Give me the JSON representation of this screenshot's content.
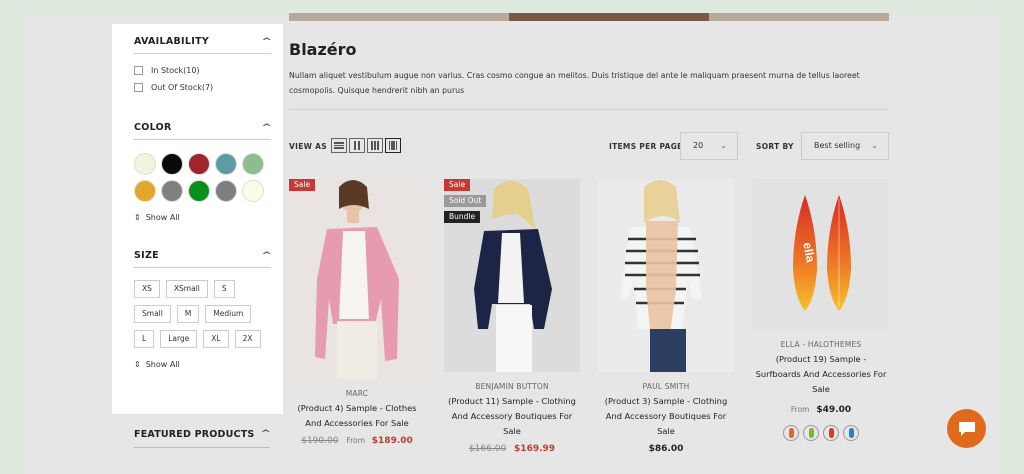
{
  "sidebar": {
    "availability": {
      "title": "AVAILABILITY",
      "options": [
        {
          "label": "In Stock(10)"
        },
        {
          "label": "Out Of Stock(7)"
        }
      ]
    },
    "color": {
      "title": "COLOR",
      "swatches": [
        "#f3f3dd",
        "#0a0a0a",
        "#a0242a",
        "#5d9ca5",
        "#8cbd8c",
        "#e1a82b",
        "#808080",
        "#0a8f1a",
        "#7e7e7e",
        "#fbfbe8"
      ],
      "show_all": "Show All"
    },
    "size": {
      "title": "SIZE",
      "options": [
        "XS",
        "XSmall",
        "S",
        "Small",
        "M",
        "Medium",
        "L",
        "Large",
        "XL",
        "2X"
      ],
      "show_all": "Show All"
    },
    "featured_title": "FEATURED PRODUCTS"
  },
  "main": {
    "title": "Blazéro",
    "description": "Nullam aliquet vestibulum augue non varius. Cras cosmo congue an melitos. Duis tristique del ante le maliquam praesent murna de tellus laoreet cosmopolis. Quisque hendrerit nibh an purus",
    "view_as_label": "VIEW AS",
    "items_per_page_label": "ITEMS PER PAGE",
    "items_per_page_value": "20",
    "sort_by_label": "SORT BY",
    "sort_by_value": "Best selling"
  },
  "products": [
    {
      "badges": [
        "Sale"
      ],
      "vendor": "MARC",
      "name": "(Product 4) Sample - Clothes And Accessories For Sale",
      "old_price": "$190.00",
      "from": "From",
      "price": "$189.00"
    },
    {
      "badges": [
        "Sale",
        "Sold Out",
        "Bundle"
      ],
      "vendor": "BENJAMIN BUTTON",
      "name": "(Product 11) Sample - Clothing And Accessory Boutiques For Sale",
      "old_price": "$166.00",
      "price": "$169.99"
    },
    {
      "badges": [],
      "vendor": "PAUL SMITH",
      "name": "(Product 3) Sample - Clothing And Accessory Boutiques For Sale",
      "price": "$86.00"
    },
    {
      "badges": [],
      "vendor": "ELLA - HALOTHEMES",
      "name": "(Product 19) Sample - Surfboards And Accessories For Sale",
      "from": "From",
      "price": "$49.00",
      "variant_colors": [
        "#e8632a",
        "#7fb32e",
        "#d93a2a",
        "#2b7fc9"
      ]
    }
  ],
  "colors": {
    "sale": "#c43a33",
    "chat": "#e06a1c"
  }
}
